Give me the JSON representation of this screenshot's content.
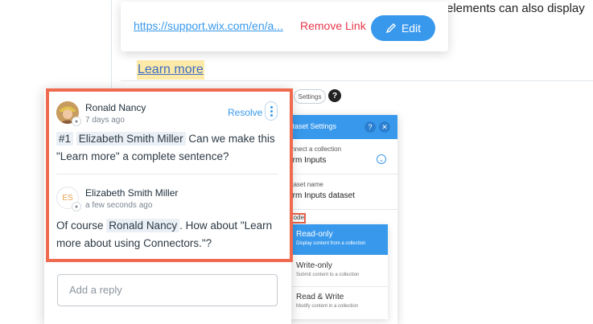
{
  "document": {
    "snippet_text": "elements can also display",
    "link_text": "Learn more"
  },
  "link_popover": {
    "url": "https://support.wix.com/en/a...",
    "remove_label": "Remove Link",
    "edit_label": "Edit"
  },
  "dataset_panel": {
    "settings_chip": "Settings",
    "help_chip": "?",
    "title": "Dataset Settings",
    "collection_label": "Connect a collection",
    "collection_value": "Form Inputs",
    "name_label": "Dataset name",
    "name_value": "Form Inputs dataset",
    "mode_label": "Mode",
    "modes": [
      {
        "name": "Read-only",
        "desc": "Display content from a collection",
        "active": true
      },
      {
        "name": "Write-only",
        "desc": "Submit content to a collection",
        "active": false
      },
      {
        "name": "Read & Write",
        "desc": "Modify content in a collection",
        "active": false
      }
    ]
  },
  "comments": {
    "thread": [
      {
        "author": "Ronald Nancy",
        "time": "7 days ago",
        "avatar": "photo-avatar",
        "resolve_label": "Resolve",
        "issue_tag": "#1",
        "mention": "Elizabeth Smith Miller",
        "text_after_mention": " Can we make this \"Learn more\" a complete sentence?"
      },
      {
        "author": "Elizabeth Smith Miller",
        "time": "a few seconds ago",
        "avatar_initials": "ES",
        "text_before_mention": "Of course ",
        "mention": "Ronald Nancy",
        "text_after_mention": ". How about \"Learn more about using Connectors.\"?"
      }
    ],
    "reply_placeholder": "Add a reply"
  },
  "colors": {
    "accent": "#3899ec",
    "remove": "#e8374a",
    "highlight_frame": "#ef6a4e",
    "link_highlight": "#fdeaa8"
  }
}
